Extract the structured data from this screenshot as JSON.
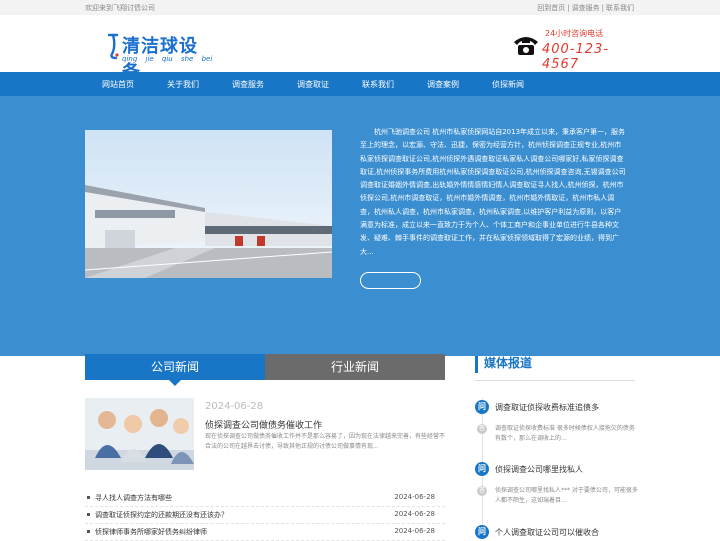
{
  "topbar": {
    "welcome": "欢迎来到飞翔讨债公司",
    "links": [
      "回到首页",
      "调查服务",
      "联系我们"
    ],
    "separator": "|"
  },
  "logo": {
    "title": "清洁球设备",
    "pinyin": "qing jie qiu she bei",
    "mark_icon": "stylized-letter-q-icon",
    "color": "#1a6fd0"
  },
  "hotline": {
    "label": "24小时咨询电话",
    "number": "400-123-4567",
    "icon": "telephone-icon",
    "color": "#e23b2e"
  },
  "nav": {
    "color": "#1976c6",
    "items": [
      "网站首页",
      "关于我们",
      "调查服务",
      "调查取证",
      "联系我们",
      "调查案例",
      "侦探新闻"
    ]
  },
  "banner": {
    "background": "#3b8ed0",
    "intro": "杭州飞驰调查公司 杭州市私家侦探网站自2013年成立以来，秉承客户第一，服务至上的理念，以宏源、守法、迅捷，保密为经营方针，杭州侦探调查正规专业,杭州市私家侦探调查取证公司,杭州侦探外遇调查取证私家私人调查公司哪家好,私家侦探调查取证,杭州侦探事务所费用杭州私家侦探调查取证公司,杭州侦探调查咨询,无锡调查公司调查取证婚姻外情调查,出轨婚外情情感情妇情人调查取证寻人找人,杭州侦探，杭州市侦探公司,杭州市调查取证，杭州市婚外情调查，杭州市婚外情取证，杭州市私人调查，杭州私人调查，杭州市私家调查，杭州私家调查,以维护客户利益为原则，以客户满意为标准，成立以来一直致力于为个人、个体工商户和企事业单位进行牛县各种文发、疑难、棘手事件的调查取证工作，并在私家侦探领域取得了宏源的业绩，得到广大..."
  },
  "news_tabs": {
    "active": "公司新闻",
    "inactive": "行业新闻"
  },
  "featured_news": {
    "date": "2024-06-28",
    "title": "侦探调查公司做债务催收工作",
    "summary": "现在侦探调查公司做债务催收工作并不是那么容易了，因为现在法律越来完善，有些经营不合法的公司在越界去讨债，导致其他正规的讨债公司做事情有现..."
  },
  "news_list": [
    {
      "title": "寻人找人调查方法有哪些",
      "date": "2024-06-28"
    },
    {
      "title": "调查取证侦探约定的还款期还没有还该办？",
      "date": "2024-06-28"
    },
    {
      "title": "侦探律师事务所哪家好债务纠纷律师",
      "date": "2024-06-28"
    }
  ],
  "media": {
    "title": "媒体报道",
    "q_label": "问",
    "a_label": "答",
    "items": [
      {
        "question": "调查取证侦探收费标准追债多",
        "answer": "调查取证侦探收费标准 很多时候债权人接拖欠的债务有数个，那么在调收上的..."
      },
      {
        "question": "侦探调查公司哪里找私人",
        "answer": "侦探调查公司哪里找私人*** 对于要债公司，可能很多人都不陌生，这如瑞着目..."
      },
      {
        "question": "个人调查取证公司可以催收合",
        "answer": ""
      }
    ]
  }
}
